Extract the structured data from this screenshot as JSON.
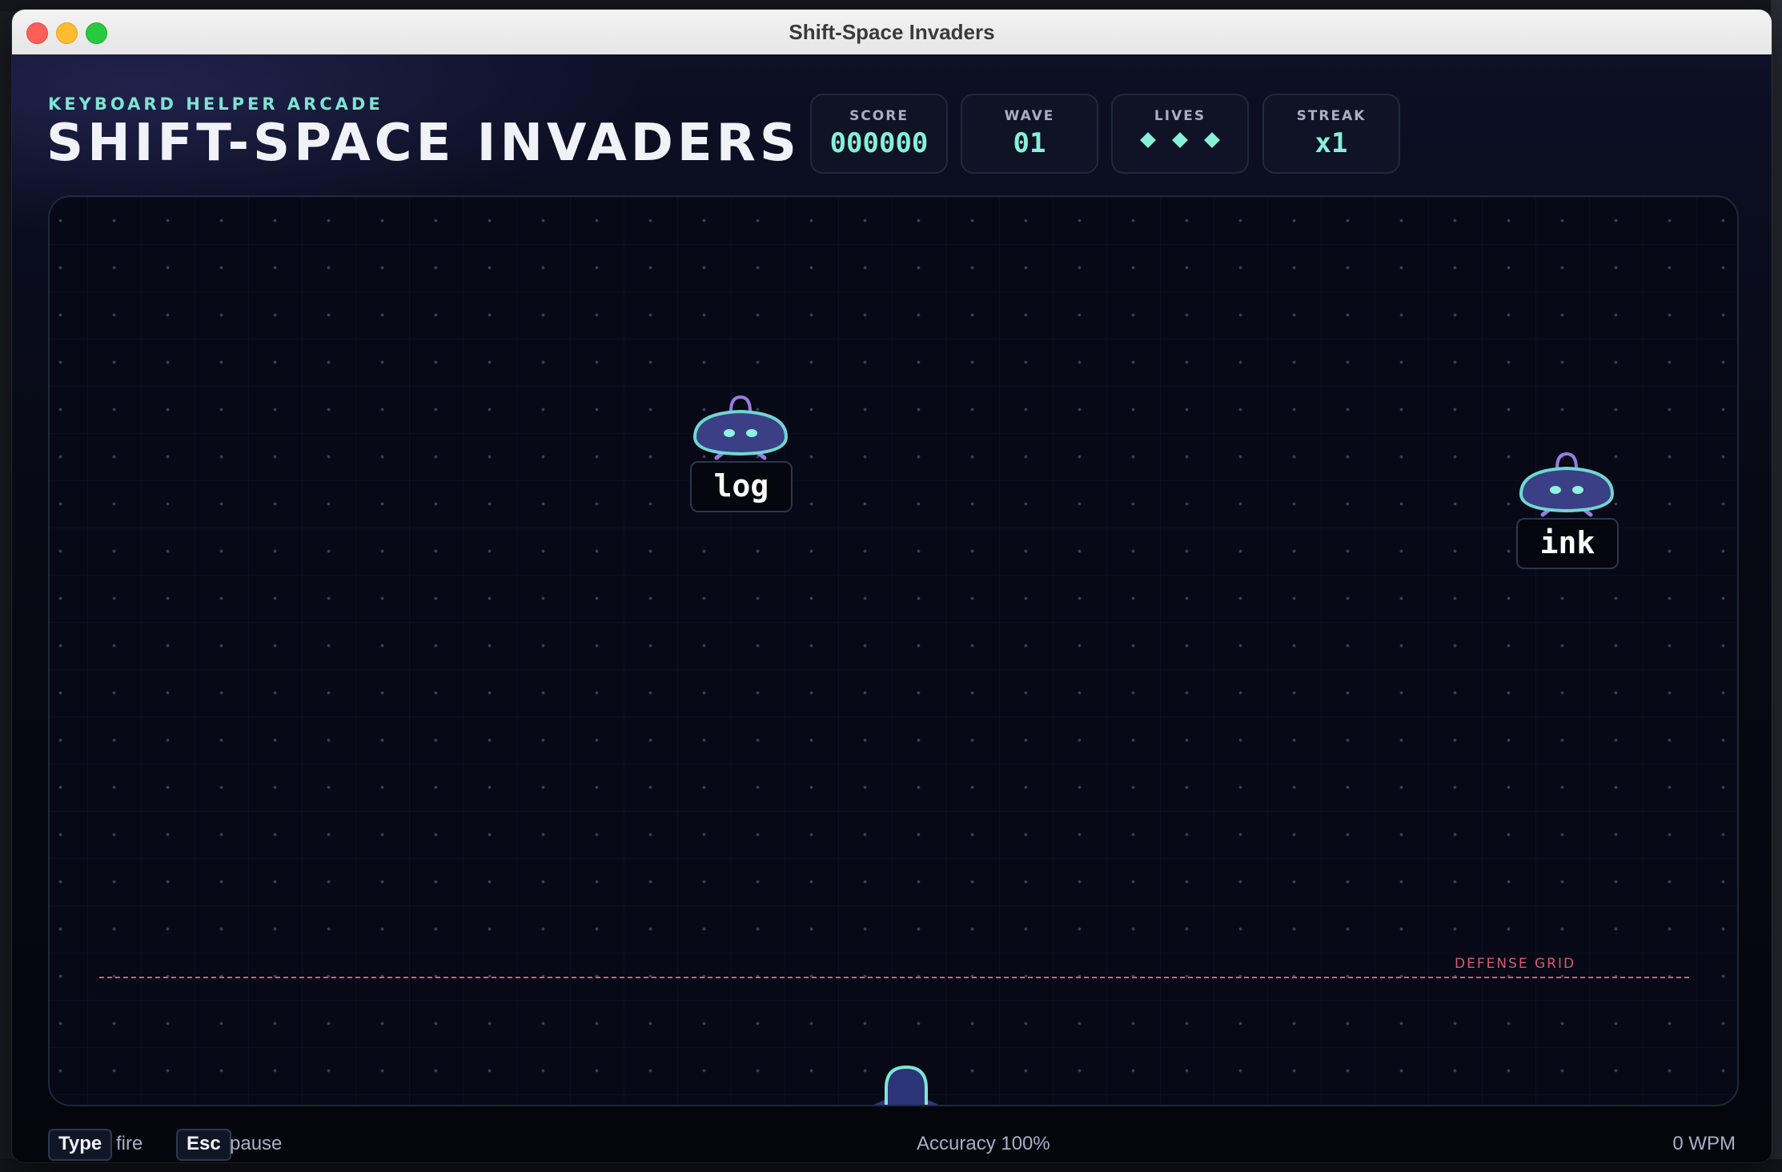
{
  "window": {
    "title": "Shift-Space Invaders"
  },
  "header": {
    "kicker": "KEYBOARD HELPER ARCADE",
    "title": "SHIFT-SPACE INVADERS"
  },
  "stats": {
    "score": {
      "label": "SCORE",
      "value": "000000"
    },
    "wave": {
      "label": "WAVE",
      "value": "01"
    },
    "lives": {
      "label": "LIVES",
      "count": 3
    },
    "streak": {
      "label": "STREAK",
      "value": "x1"
    }
  },
  "playfield": {
    "defense_label": "DEFENSE GRID",
    "invaders": [
      {
        "word": "log"
      },
      {
        "word": "ink"
      }
    ]
  },
  "footer": {
    "fire_key": "Type",
    "fire_desc": "fire",
    "pause_key": "Esc",
    "pause_desc": "pause",
    "accuracy": "Accuracy 100%",
    "wpm": "0 WPM"
  },
  "colors": {
    "accent": "#86f0d8",
    "danger": "#d65a74",
    "invader_body": "#3b3f86",
    "invader_outline": "#6fd7d0",
    "invader_antenna": "#9b7be0"
  }
}
